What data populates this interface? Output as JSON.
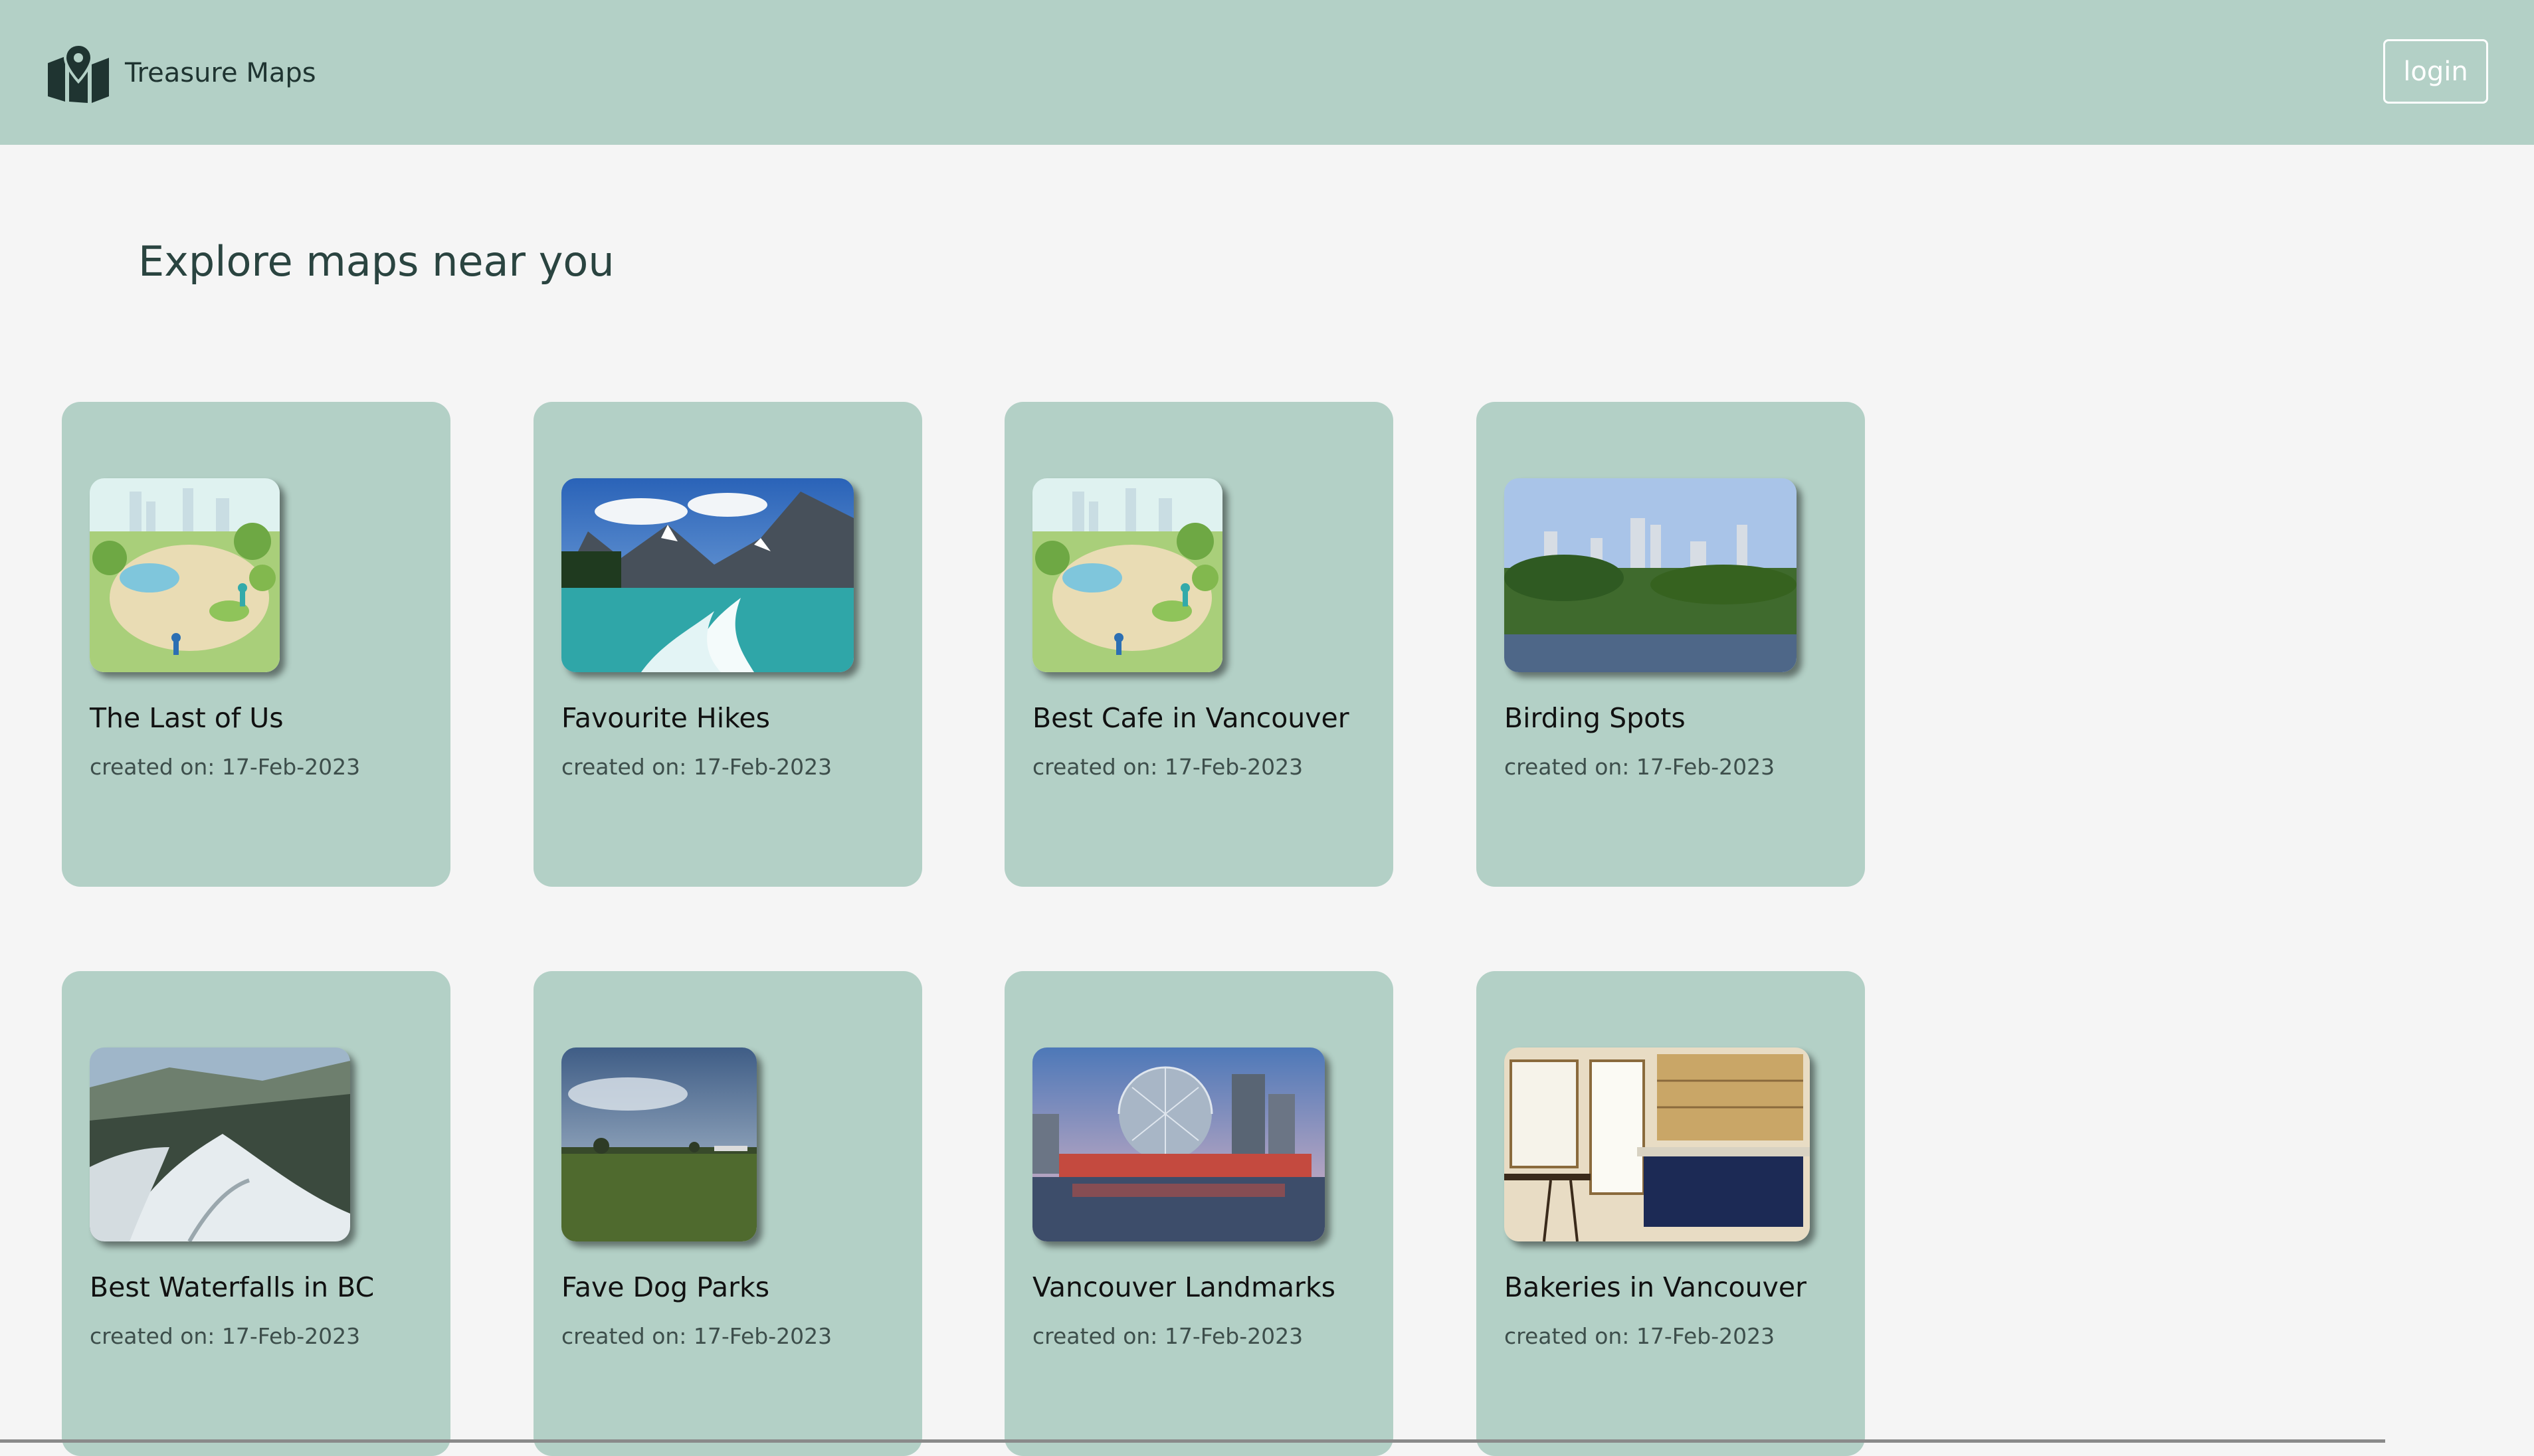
{
  "header": {
    "app_name": "Treasure Maps",
    "logo_icon": "map-pin-icon",
    "login_label": "login",
    "background_color": "#b3d0c6"
  },
  "main": {
    "heading": "Explore maps near you",
    "cards": [
      {
        "title": "The Last of Us",
        "created": "created on: 17-Feb-2023",
        "image": "park-illustration"
      },
      {
        "title": "Favourite Hikes",
        "created": "created on: 17-Feb-2023",
        "image": "mountain-lake-photo"
      },
      {
        "title": "Best Cafe in Vancouver",
        "created": "created on: 17-Feb-2023",
        "image": "park-illustration"
      },
      {
        "title": "Birding Spots",
        "created": "created on: 17-Feb-2023",
        "image": "city-skyline-photo"
      },
      {
        "title": "Best Waterfalls in BC",
        "created": "created on: 17-Feb-2023",
        "image": "snowy-canyon-photo"
      },
      {
        "title": "Fave Dog Parks",
        "created": "created on: 17-Feb-2023",
        "image": "grass-field-photo"
      },
      {
        "title": "Vancouver Landmarks",
        "created": "created on: 17-Feb-2023",
        "image": "science-world-dome-photo"
      },
      {
        "title": "Bakeries in Vancouver",
        "created": "created on: 17-Feb-2023",
        "image": "bakery-interior-photo"
      }
    ]
  }
}
